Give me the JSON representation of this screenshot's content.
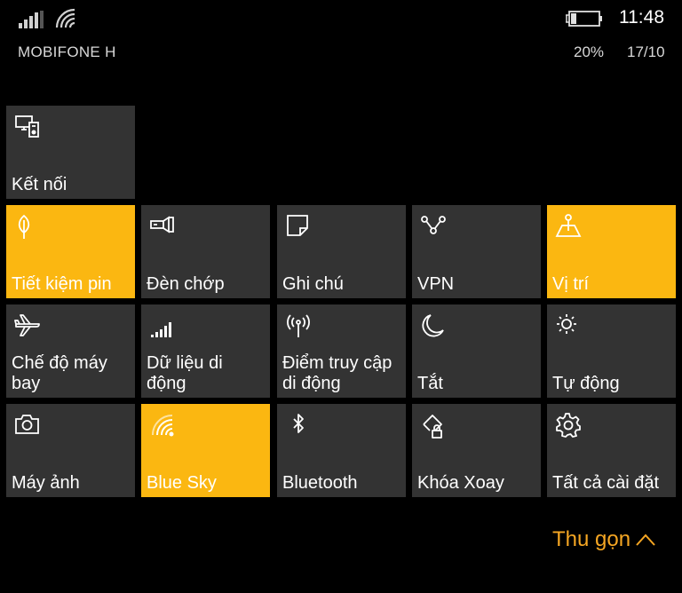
{
  "status_bar": {
    "time": "11:48",
    "carrier": "MOBIFONE H",
    "battery_percent": "20%",
    "date": "17/10",
    "signal_icon": "signal-bars-icon",
    "wifi_icon": "wifi-icon",
    "battery_icon": "battery-charging-icon"
  },
  "colors": {
    "tile_off": "#333333",
    "tile_on": "#fbb711",
    "accent_text": "#f5a623"
  },
  "tiles": [
    {
      "label": "Kết nối",
      "icon": "connect-icon",
      "active": false
    },
    {
      "label": "Tiết kiệm pin",
      "icon": "battery-saver-leaf-icon",
      "active": true
    },
    {
      "label": "Đèn chớp",
      "icon": "flashlight-icon",
      "active": false
    },
    {
      "label": "Ghi chú",
      "icon": "note-icon",
      "active": false
    },
    {
      "label": "VPN",
      "icon": "vpn-icon",
      "active": false
    },
    {
      "label": "Vị trí",
      "icon": "location-icon",
      "active": true
    },
    {
      "label": "Chế độ máy bay",
      "icon": "airplane-icon",
      "active": false
    },
    {
      "label": "Dữ liệu di động",
      "icon": "cellular-data-icon",
      "active": false
    },
    {
      "label": "Điểm truy cập di động",
      "icon": "mobile-hotspot-icon",
      "active": false
    },
    {
      "label": "Tắt",
      "icon": "quiet-hours-moon-icon",
      "active": false
    },
    {
      "label": "Tự động",
      "icon": "brightness-icon",
      "active": false
    },
    {
      "label": "Máy ảnh",
      "icon": "camera-icon",
      "active": false
    },
    {
      "label": "Blue Sky",
      "icon": "wifi-icon",
      "active": true
    },
    {
      "label": "Bluetooth",
      "icon": "bluetooth-icon",
      "active": false
    },
    {
      "label": "Khóa Xoay",
      "icon": "rotation-lock-icon",
      "active": false
    },
    {
      "label": "Tất cả cài đặt",
      "icon": "settings-gear-icon",
      "active": false
    }
  ],
  "collapse": {
    "label": "Thu gọn",
    "icon": "chevron-up-icon"
  }
}
